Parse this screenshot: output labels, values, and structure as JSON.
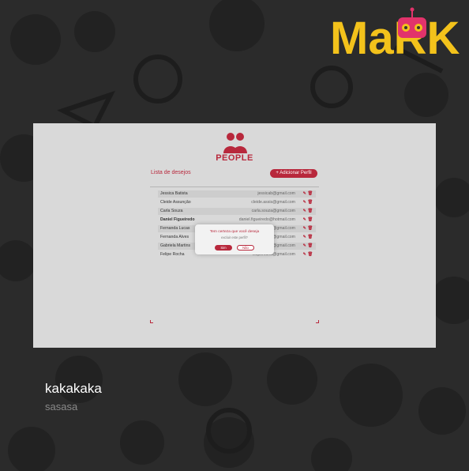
{
  "brand": {
    "logo_text": "MaRK",
    "logo_color": "#f3c21b",
    "robot_color": "#e2336b"
  },
  "card": {
    "app_name": "PEOPLE",
    "list_title": "Lista de desejos",
    "add_button": "+ Adicionar Perfil",
    "accent_color": "#b8283c",
    "rows": [
      {
        "name": "Jessica Batista",
        "email": "jessicab@gmail.com",
        "actions": "✎ 🗑"
      },
      {
        "name": "Cleide Assunção",
        "email": "cleide.assis@gmail.com",
        "actions": "✎ 🗑"
      },
      {
        "name": "Carla Souza",
        "email": "carla.souza@gmail.com",
        "actions": "✎ 🗑"
      },
      {
        "name": "Daniel Figueiredo",
        "email": "daniel.figueiredo@hotmail.com",
        "actions": "✎ 🗑"
      },
      {
        "name": "Fernanda Lucas",
        "email": "fernandalucas@gmail.com",
        "actions": "✎ 🗑"
      },
      {
        "name": "Fernanda Alves",
        "email": "fernanda.alves@gmail.com",
        "actions": "✎ 🗑"
      },
      {
        "name": "Gabriela Martins",
        "email": "gabriela.martins@gmail.com",
        "actions": "✎ 🗑"
      },
      {
        "name": "Felipe Rocha",
        "email": "feliperocha@gmail.com",
        "actions": "✎ 🗑"
      }
    ],
    "dialog": {
      "message": "Tem certeza que você deseja",
      "sub_message": "excluir este perfil?",
      "confirm": "Sim",
      "cancel": "Não"
    }
  },
  "caption": {
    "title": "kakakaka",
    "subtitle": "sasasa"
  }
}
